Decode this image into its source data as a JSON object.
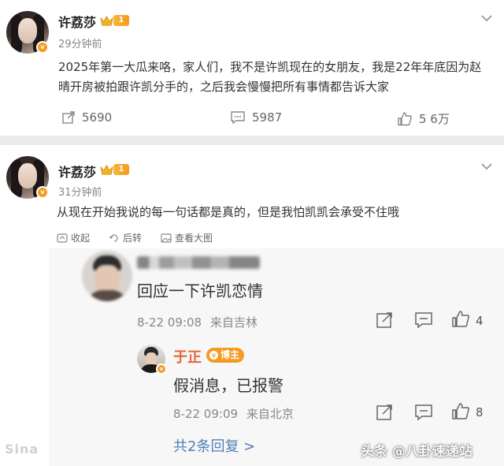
{
  "post1": {
    "username": "许荔莎",
    "level": "1",
    "time": "29分钟前",
    "content_line1": "2025年第一大瓜来咯，家人们，我不是许凯现在的女朋友，我是22年年底因为赵",
    "content_line2": "晴开房被拍跟许凯分手的，之后我会慢慢把所有事情都告诉大家",
    "reposts": "5690",
    "comments": "5987",
    "likes": "5 6万"
  },
  "post2": {
    "username": "许荔莎",
    "level": "1",
    "time": "31分钟前",
    "content": "从现在开始我说的每一句话都是真的，但是我怕凯凯会承受不住哦",
    "actions": {
      "collapse": "收起",
      "repost": "后转",
      "view_image": "查看大图"
    }
  },
  "comment": {
    "text": "回应一下许凯恋情",
    "date": "8-22 09:08",
    "location": "来自吉林",
    "likes": "4"
  },
  "reply": {
    "username": "于正",
    "badge": "博主",
    "text": "假消息，已报警",
    "date": "8-22 09:09",
    "location": "来自北京",
    "likes": "8"
  },
  "more_replies": "共2条回复 >",
  "watermark": "头条 @八卦速递站",
  "colors": {
    "accent_orange": "#f59a23",
    "link_blue": "#4f7fb6",
    "reply_name": "#e8643c"
  }
}
